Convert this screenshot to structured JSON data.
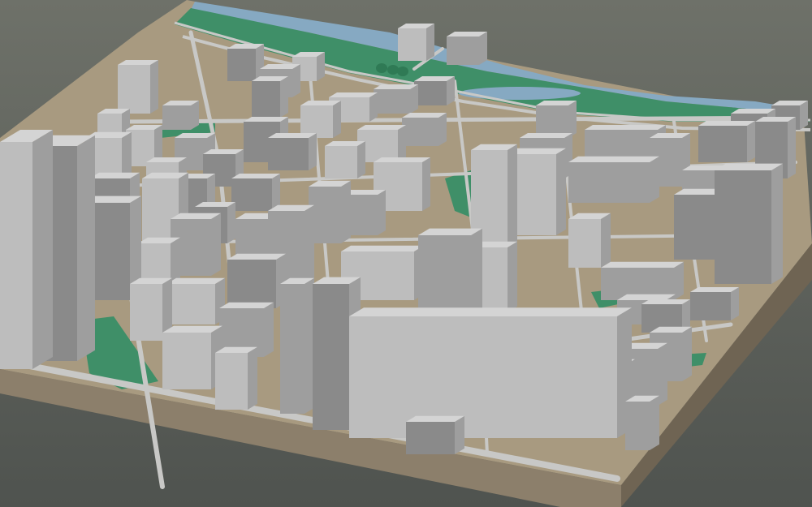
{
  "scene": {
    "kind": "3d-city-model-viewport",
    "colors": {
      "background_top": "#6e7169",
      "background_bottom": "#4f534f",
      "base_side": "#8c7f6b",
      "base_side_dark": "#6f6453",
      "ground": "#a89a80",
      "street": "#c8c8c6",
      "park": "#3f8f68",
      "park_light": "#4da57a",
      "water": "#86a9c2",
      "building_light": "#d4d4d4",
      "building_mid": "#bdbdbd",
      "building_dark": "#9e9e9e",
      "building_shadow": "#8a8a8a"
    }
  }
}
